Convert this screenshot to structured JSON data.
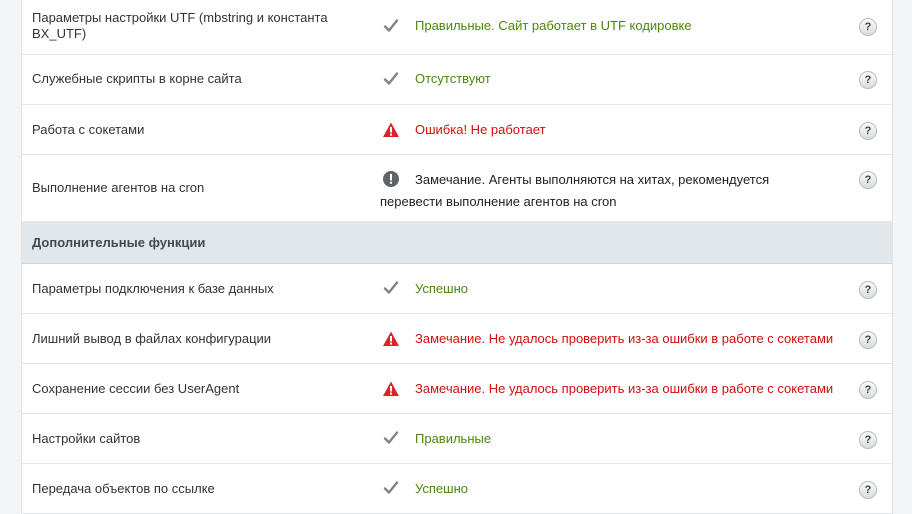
{
  "rows": [
    {
      "label": "Параметры настройки UTF (mbstring и константа BX_UTF)",
      "status": "Правильные. Сайт работает в UTF кодировке",
      "help": "?"
    },
    {
      "label": "Служебные скрипты в корне сайта",
      "status": "Отсутствуют",
      "help": "?"
    },
    {
      "label": "Работа с сокетами",
      "status": "Ошибка! Не работает",
      "help": "?"
    },
    {
      "label": "Выполнение агентов на cron",
      "status": "Замечание. Агенты выполняются на хитах, рекомендуется перевести выполнение агентов на cron",
      "help": "?"
    },
    {
      "label": "Дополнительные функции"
    },
    {
      "label": "Параметры подключения к базе данных",
      "status": "Успешно",
      "help": "?"
    },
    {
      "label": "Лишний вывод в файлах конфигурации",
      "status": "Замечание. Не удалось проверить из-за ошибки в работе с сокетами",
      "help": "?"
    },
    {
      "label": "Сохранение сессии без UserAgent",
      "status": "Замечание. Не удалось проверить из-за ошибки в работе с сокетами",
      "help": "?"
    },
    {
      "label": "Настройки сайтов",
      "status": "Правильные",
      "help": "?"
    },
    {
      "label": "Передача объектов по ссылке",
      "status": "Успешно",
      "help": "?"
    }
  ],
  "icons": {
    "ok": "check-icon",
    "error": "warning-triangle-icon",
    "notice": "exclamation-circle-icon",
    "help": "question-icon"
  },
  "colors": {
    "ok": "#49880b",
    "error": "#d20f0f",
    "section_bg": "#e1e7ea"
  }
}
